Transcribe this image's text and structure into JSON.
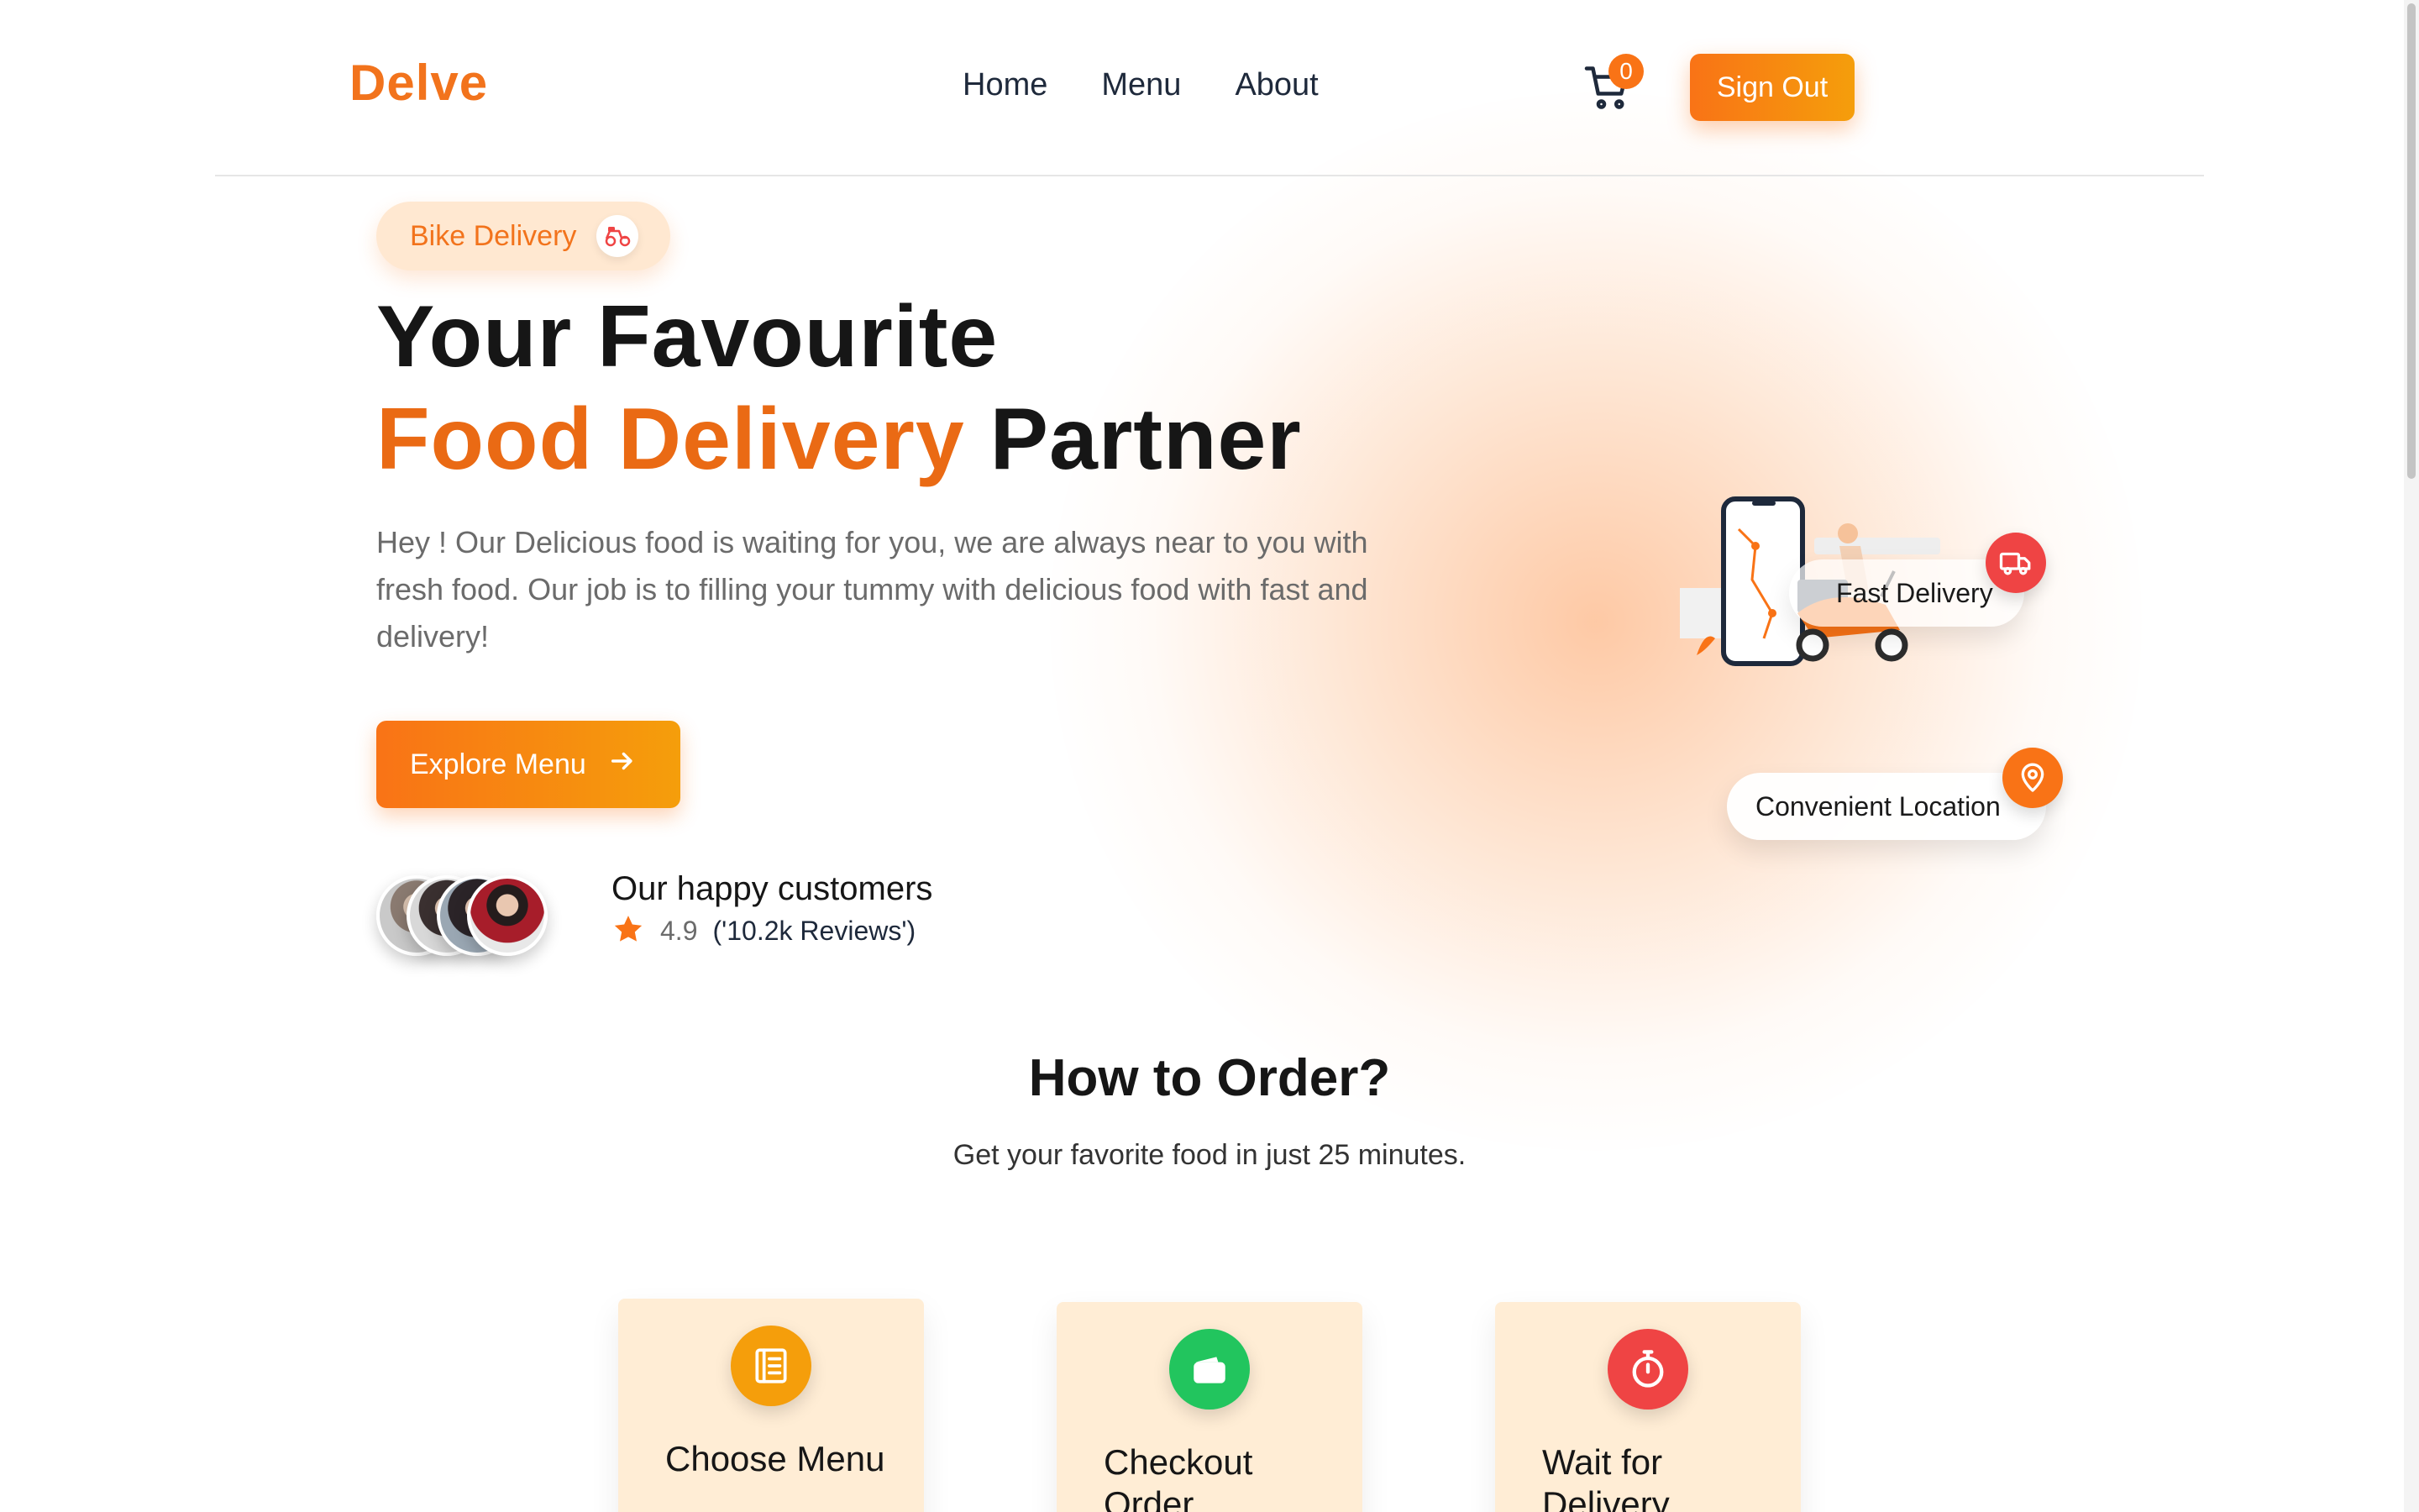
{
  "header": {
    "logo": "Delve",
    "nav": [
      {
        "label": "Home"
      },
      {
        "label": "Menu"
      },
      {
        "label": "About"
      }
    ],
    "cart_count": "0",
    "sign_out": "Sign Out"
  },
  "hero": {
    "pill_label": "Bike Delivery",
    "title_line1": "Your Favourite",
    "title_accent": "Food Delivery",
    "title_rest": " Partner",
    "description": "Hey ! Our Delicious food is waiting for you, we are always near to you with fresh food. Our job is to filling your tummy with delicious food with fast and delivery!",
    "cta": "Explore Menu",
    "customers_title": "Our happy customers",
    "rating": "4.9",
    "reviews": "('10.2k Reviews')"
  },
  "floating": {
    "fast_delivery": "Fast Delivery",
    "convenient_location": "Convenient Location"
  },
  "how_to_order": {
    "title": "How to Order?",
    "subtitle": "Get your favorite food in just 25 minutes.",
    "steps": [
      {
        "label": "Choose Menu",
        "icon": "menu-book-icon",
        "color": "#f59e0b"
      },
      {
        "label": "Checkout Order",
        "icon": "wallet-icon",
        "color": "#22c55e"
      },
      {
        "label": "Wait for Delivery",
        "icon": "stopwatch-icon",
        "color": "#ef4444"
      }
    ]
  },
  "colors": {
    "brand": "#f2731c",
    "accent_text": "#ea6a14",
    "card_bg": "#ffedd5"
  }
}
